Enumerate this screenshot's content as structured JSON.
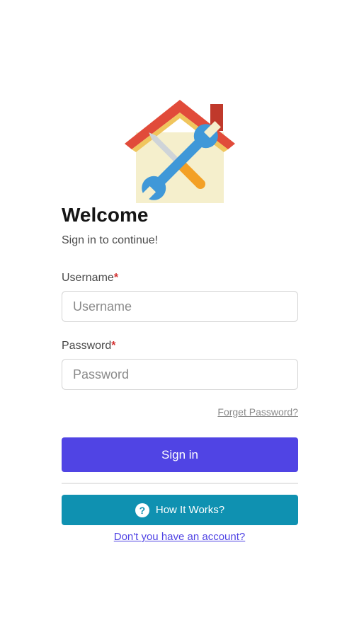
{
  "logo": {
    "icon": "house-tools-logo",
    "colors": {
      "roof": "#e14b3a",
      "wall": "#f5efcc",
      "wrench": "#3f98d8",
      "handle": "#f3a025",
      "chimney": "#c0392b"
    }
  },
  "header": {
    "title": "Welcome",
    "subtitle": "Sign in to continue!"
  },
  "form": {
    "username": {
      "label": "Username",
      "required_mark": "*",
      "placeholder": "Username",
      "value": ""
    },
    "password": {
      "label": "Password",
      "required_mark": "*",
      "placeholder": "Password",
      "value": ""
    },
    "forgot_label": "Forget Password?",
    "signin_label": "Sign in"
  },
  "help": {
    "label": "How It Works?",
    "icon": "question-circle-icon"
  },
  "signup_link": "Don't you have an account?",
  "colors": {
    "primary": "#5044e4",
    "help": "#0f91b1",
    "required": "#d32f2f"
  }
}
